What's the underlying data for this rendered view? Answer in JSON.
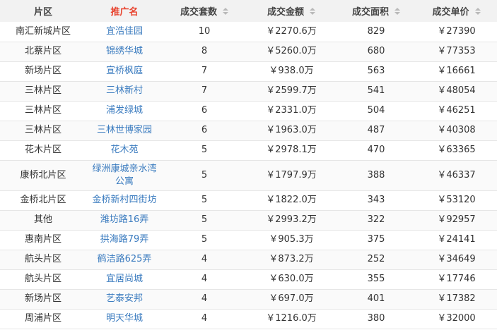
{
  "headers": {
    "district": "片区",
    "project": "推广名",
    "count": "成交套数",
    "amount": "成交金额",
    "area": "成交面积",
    "unit_price": "成交单价"
  },
  "colors": {
    "project_header": "#e8432e",
    "link": "#3a7bbf",
    "header_bg": "#f2f2f2"
  },
  "sort_icon": "sort-updown-icon",
  "rows": [
    {
      "district": "南汇新城片区",
      "name": "宜浩佳园",
      "count": "10",
      "amount": "￥2270.6万",
      "area": "829",
      "price": "￥27390"
    },
    {
      "district": "北蔡片区",
      "name": "锦绣华城",
      "count": "8",
      "amount": "￥5260.0万",
      "area": "680",
      "price": "￥77353"
    },
    {
      "district": "新场片区",
      "name": "宣桥枫庭",
      "count": "7",
      "amount": "￥938.0万",
      "area": "563",
      "price": "￥16661"
    },
    {
      "district": "三林片区",
      "name": "三林新村",
      "count": "7",
      "amount": "￥2599.7万",
      "area": "541",
      "price": "￥48054"
    },
    {
      "district": "三林片区",
      "name": "浦发绿城",
      "count": "6",
      "amount": "￥2331.0万",
      "area": "504",
      "price": "￥46251"
    },
    {
      "district": "三林片区",
      "name": "三林世博家园",
      "count": "6",
      "amount": "￥1963.0万",
      "area": "487",
      "price": "￥40308"
    },
    {
      "district": "花木片区",
      "name": "花木苑",
      "count": "5",
      "amount": "￥2978.1万",
      "area": "470",
      "price": "￥63365"
    },
    {
      "district": "康桥北片区",
      "name": "绿洲康城亲水湾公寓",
      "count": "5",
      "amount": "￥1797.9万",
      "area": "388",
      "price": "￥46337"
    },
    {
      "district": "金桥北片区",
      "name": "金桥新村四街坊",
      "count": "5",
      "amount": "￥1822.0万",
      "area": "343",
      "price": "￥53120"
    },
    {
      "district": "其他",
      "name": "潍坊路16弄",
      "count": "5",
      "amount": "￥2993.2万",
      "area": "322",
      "price": "￥92957"
    },
    {
      "district": "惠南片区",
      "name": "拱海路79弄",
      "count": "5",
      "amount": "￥905.3万",
      "area": "375",
      "price": "￥24141"
    },
    {
      "district": "航头片区",
      "name": "鹤洁路625弄",
      "count": "4",
      "amount": "￥873.2万",
      "area": "252",
      "price": "￥34649"
    },
    {
      "district": "航头片区",
      "name": "宜居尚城",
      "count": "4",
      "amount": "￥630.0万",
      "area": "355",
      "price": "￥17746"
    },
    {
      "district": "新场片区",
      "name": "艺泰安邦",
      "count": "4",
      "amount": "￥697.0万",
      "area": "401",
      "price": "￥17382"
    },
    {
      "district": "周浦片区",
      "name": "明天华城",
      "count": "4",
      "amount": "￥1216.0万",
      "area": "380",
      "price": "￥32000"
    }
  ]
}
